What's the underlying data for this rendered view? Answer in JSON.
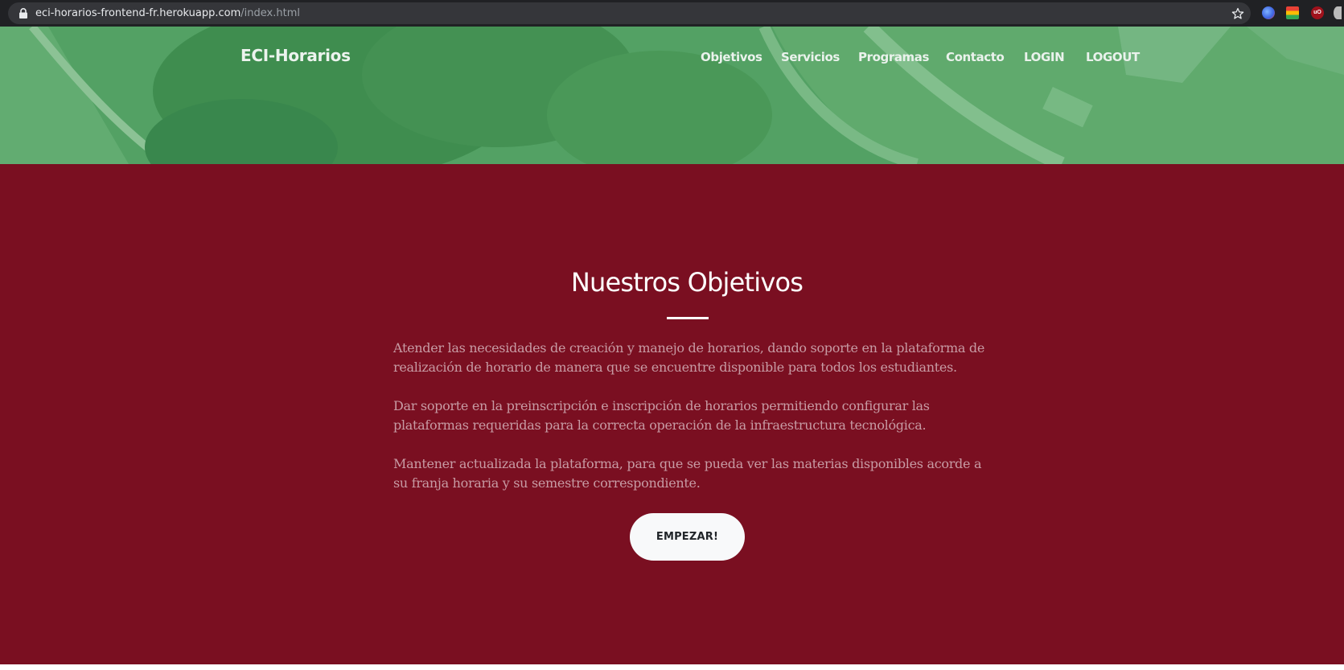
{
  "browser": {
    "url_host": "eci-horarios-frontend-fr.herokuapp.com",
    "url_path": "/index.html",
    "icons": [
      "lock-icon",
      "star-icon",
      "extension-icon",
      "ublock-icon"
    ]
  },
  "header": {
    "brand": "ECI-Horarios",
    "nav": [
      "Objetivos",
      "Servicios",
      "Programas",
      "Contacto",
      "LOGIN",
      "LOGOUT"
    ]
  },
  "objectives": {
    "title": "Nuestros Objetivos",
    "paragraphs": [
      "Atender las necesidades de creación y manejo de horarios, dando soporte en la plataforma de realización de horario de manera que se encuentre disponible para todos los estudiantes.",
      "Dar soporte en la preinscripción e inscripción de horarios permitiendo configurar las plataformas requeridas para la correcta operación de la infraestructura tecnológica.",
      "Mantener actualizada la plataforma, para que se pueda ver las materias disponibles acorde a su franja horaria y su semestre correspondiente."
    ],
    "cta_label": "EMPEZAR!"
  },
  "colors": {
    "section_background": "#7a0f21",
    "hero_overlay": "#4a9a5c",
    "button_background": "#f8f9fa"
  }
}
